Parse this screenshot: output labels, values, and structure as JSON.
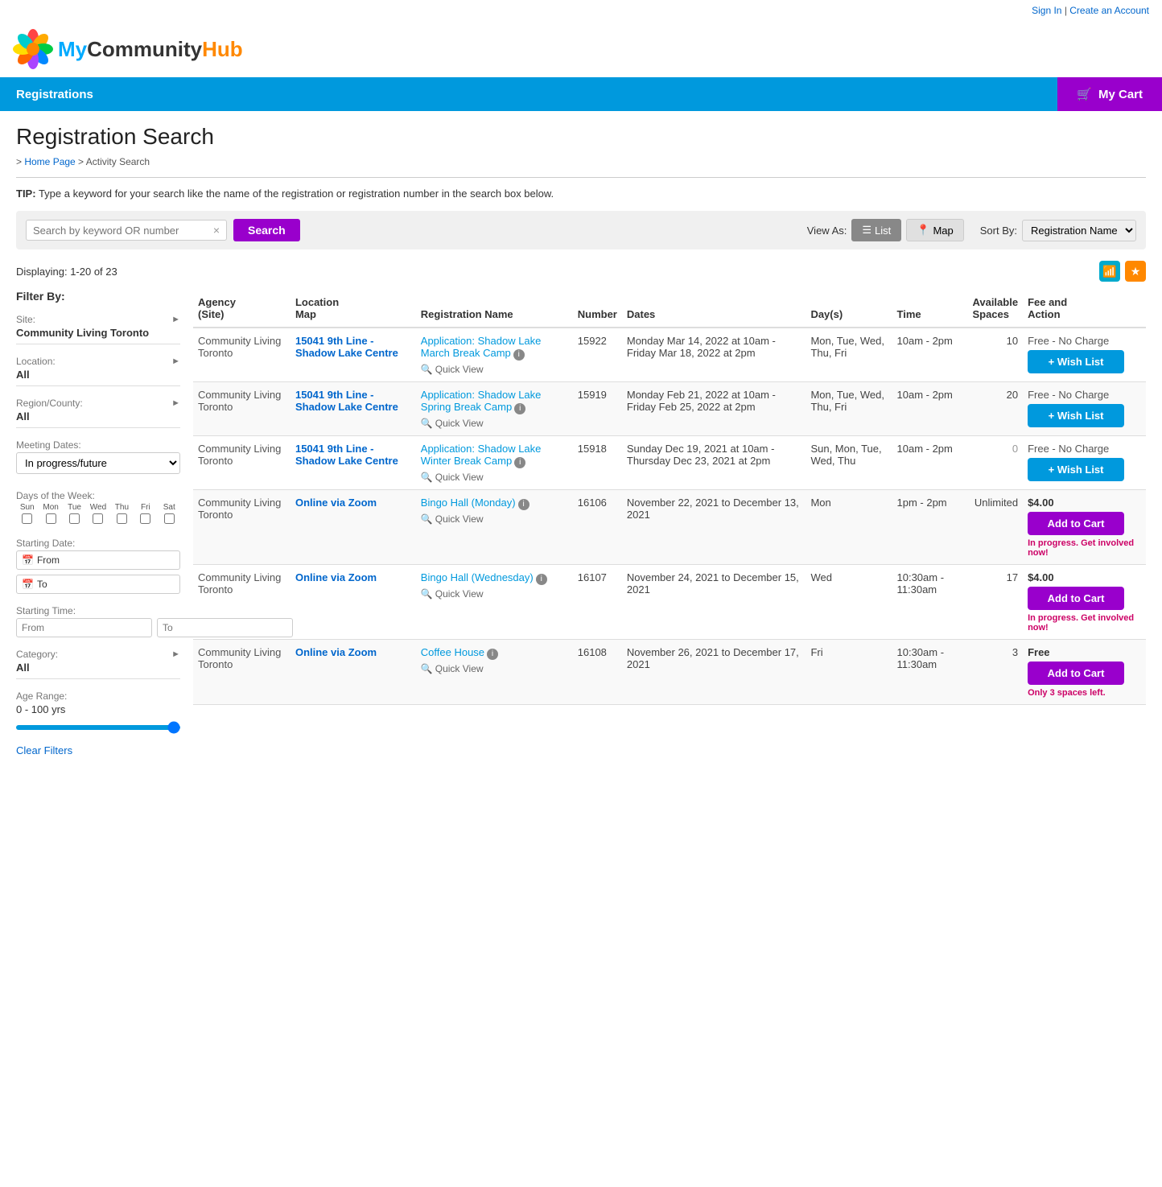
{
  "topbar": {
    "signin": "Sign In",
    "separator": "|",
    "create_account": "Create an Account"
  },
  "logo": {
    "my": "My",
    "community": "Community",
    "hub": "Hub"
  },
  "nav": {
    "registrations": "Registrations",
    "cart": "My Cart"
  },
  "page": {
    "title": "Registration Search",
    "breadcrumb_home": "Home Page",
    "breadcrumb_activity": "Activity Search",
    "tip_label": "TIP:",
    "tip_text": "Type a keyword for your search like the name of the registration or registration number in the search box below."
  },
  "search": {
    "placeholder": "Search by keyword OR number",
    "clear_label": "×",
    "button_label": "Search",
    "view_as_label": "View As:",
    "list_label": "List",
    "map_label": "Map",
    "sort_by_label": "Sort By:",
    "sort_option": "Registration Name"
  },
  "results": {
    "displaying": "Displaying: 1-20 of 23"
  },
  "filter": {
    "filter_by": "Filter By:",
    "site_label": "Site:",
    "site_value": "Community Living Toronto",
    "location_label": "Location:",
    "location_value": "All",
    "region_label": "Region/County:",
    "region_value": "All",
    "meeting_dates_label": "Meeting Dates:",
    "meeting_dates_option": "In progress/future",
    "days_label": "Days of the Week:",
    "days": [
      "Sun",
      "Mon",
      "Tue",
      "Wed",
      "Thu",
      "Fri",
      "Sat"
    ],
    "starting_date_label": "Starting Date:",
    "from_label": "From",
    "to_label": "To",
    "starting_time_label": "Starting Time:",
    "time_from": "From",
    "time_to": "To",
    "category_label": "Category:",
    "category_value": "All",
    "age_range_label": "Age Range:",
    "age_range_value": "0 - 100 yrs",
    "clear_filters": "Clear Filters"
  },
  "table": {
    "headers": [
      "Agency (Site)",
      "Location Map",
      "Registration Name",
      "Number",
      "Dates",
      "Day(s)",
      "Time",
      "Available Spaces",
      "Fee and Action"
    ],
    "rows": [
      {
        "agency": "Community Living Toronto",
        "location_link": "15041 9th Line - Shadow Lake Centre",
        "reg_name": "Application: Shadow Lake March Break Camp",
        "number": "15922",
        "dates": "Monday Mar 14, 2022 at 10am - Friday Mar 18, 2022 at 2pm",
        "days": "Mon, Tue, Wed, Thu, Fri",
        "time": "10am - 2pm",
        "spaces": "10",
        "fee": "Free - No Charge",
        "action_label": "+ Wish List",
        "action_type": "wish",
        "in_progress": "",
        "spaces_note": ""
      },
      {
        "agency": "Community Living Toronto",
        "location_link": "15041 9th Line - Shadow Lake Centre",
        "reg_name": "Application: Shadow Lake Spring Break Camp",
        "number": "15919",
        "dates": "Monday Feb 21, 2022 at 10am - Friday Feb 25, 2022 at 2pm",
        "days": "Mon, Tue, Wed, Thu, Fri",
        "time": "10am - 2pm",
        "spaces": "20",
        "fee": "Free - No Charge",
        "action_label": "+ Wish List",
        "action_type": "wish",
        "in_progress": "",
        "spaces_note": ""
      },
      {
        "agency": "Community Living Toronto",
        "location_link": "15041 9th Line - Shadow Lake Centre",
        "reg_name": "Application: Shadow Lake Winter Break Camp",
        "number": "15918",
        "dates": "Sunday Dec 19, 2021 at 10am - Thursday Dec 23, 2021 at 2pm",
        "days": "Sun, Mon, Tue, Wed, Thu",
        "time": "10am - 2pm",
        "spaces": "0",
        "fee": "Free - No Charge",
        "action_label": "+ Wish List",
        "action_type": "wish",
        "in_progress": "",
        "spaces_note": ""
      },
      {
        "agency": "Community Living Toronto",
        "location_link": "Online via Zoom",
        "reg_name": "Bingo Hall (Monday)",
        "number": "16106",
        "dates": "November 22, 2021 to December 13, 2021",
        "days": "Mon",
        "time": "1pm - 2pm",
        "spaces": "Unlimited",
        "fee": "$4.00",
        "action_label": "Add to Cart",
        "action_type": "cart",
        "in_progress": "In progress. Get involved now!",
        "spaces_note": ""
      },
      {
        "agency": "Community Living Toronto",
        "location_link": "Online via Zoom",
        "reg_name": "Bingo Hall (Wednesday)",
        "number": "16107",
        "dates": "November 24, 2021 to December 15, 2021",
        "days": "Wed",
        "time": "10:30am - 11:30am",
        "spaces": "17",
        "fee": "$4.00",
        "action_label": "Add to Cart",
        "action_type": "cart",
        "in_progress": "In progress. Get involved now!",
        "spaces_note": ""
      },
      {
        "agency": "Community Living Toronto",
        "location_link": "Online via Zoom",
        "reg_name": "Coffee House",
        "number": "16108",
        "dates": "November 26, 2021 to December 17, 2021",
        "days": "Fri",
        "time": "10:30am - 11:30am",
        "spaces": "3",
        "fee": "Free",
        "action_label": "Add to Cart",
        "action_type": "cart",
        "in_progress": "",
        "spaces_note": "Only 3 spaces left."
      }
    ]
  }
}
